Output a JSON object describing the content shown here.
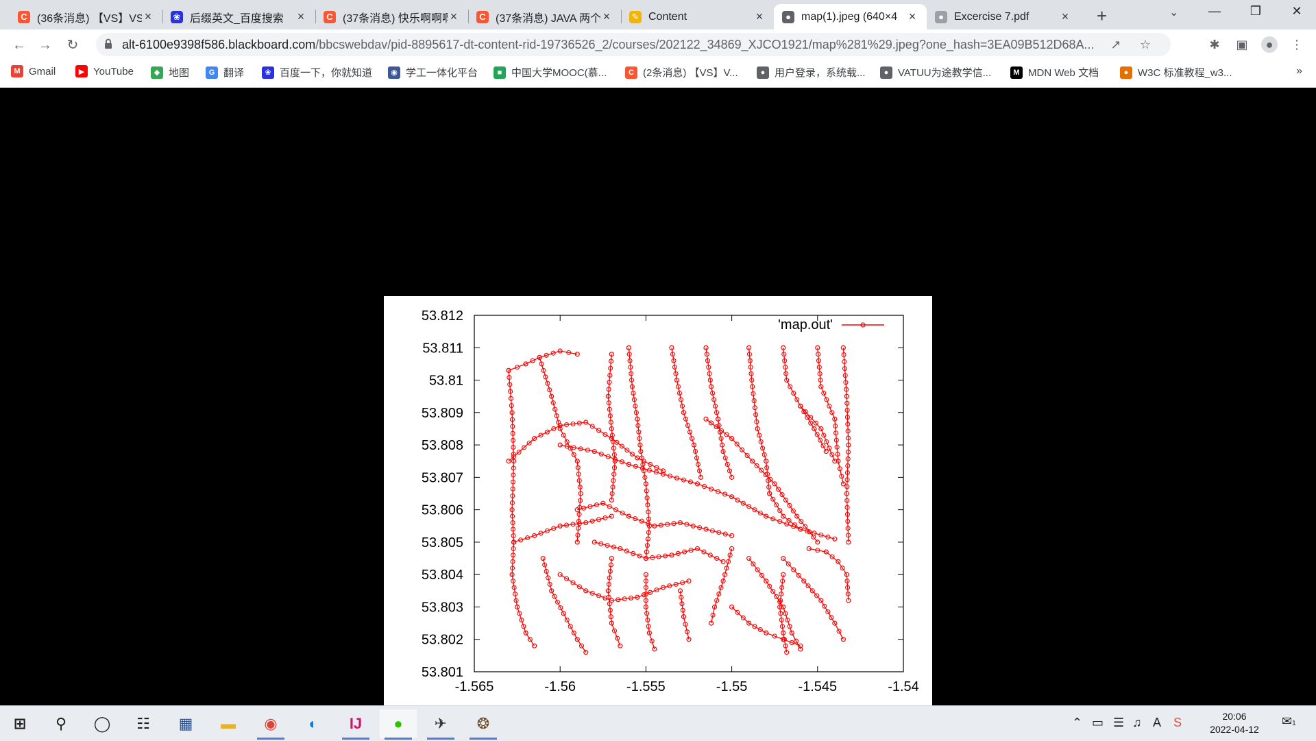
{
  "browser": {
    "tabs": [
      {
        "title": "(36条消息) 【VS】VS",
        "favicon": "csdn-icon",
        "color": "#fc5531"
      },
      {
        "title": "后缀英文_百度搜索",
        "favicon": "baidu-icon",
        "color": "#2932e1"
      },
      {
        "title": "(37条消息) 快乐啊啊啊",
        "favicon": "csdn-icon",
        "color": "#fc5531"
      },
      {
        "title": "(37条消息) JAVA 两个",
        "favicon": "csdn-icon",
        "color": "#fc5531"
      },
      {
        "title": "Content",
        "favicon": "blackboard-icon",
        "color": "#f4b400"
      },
      {
        "title": "map(1).jpeg (640×4",
        "favicon": "globe-icon",
        "color": "#5f6368",
        "active": true
      },
      {
        "title": "Excercise 7.pdf",
        "favicon": "globe-icon",
        "color": "#9aa0a6"
      }
    ],
    "url_host": "alt-6100e9398f586.blackboard.com",
    "url_path": "/bbcswebdav/pid-8895617-dt-content-rid-19736526_2/courses/202122_34869_XJCO1921/map%281%29.jpeg?one_hash=3EA09B512D68A...",
    "bookmarks": [
      {
        "label": "Gmail",
        "icon": "gmail-icon",
        "color": "#ea4335"
      },
      {
        "label": "YouTube",
        "icon": "youtube-icon",
        "color": "#ff0000"
      },
      {
        "label": "地图",
        "icon": "maps-icon",
        "color": "#34a853"
      },
      {
        "label": "翻译",
        "icon": "translate-icon",
        "color": "#4285f4"
      },
      {
        "label": "百度一下，你就知道",
        "icon": "baidu-icon",
        "color": "#2932e1"
      },
      {
        "label": "学工一体化平台",
        "icon": "school-icon",
        "color": "#3b5998"
      },
      {
        "label": "中国大学MOOC(慕...",
        "icon": "mooc-icon",
        "color": "#21a557"
      },
      {
        "label": "(2条消息) 【VS】V...",
        "icon": "csdn-icon",
        "color": "#fc5531"
      },
      {
        "label": "用户登录，系统载...",
        "icon": "globe-icon",
        "color": "#5f6368"
      },
      {
        "label": "VATUU为途教学信...",
        "icon": "globe-icon",
        "color": "#5f6368"
      },
      {
        "label": "MDN Web 文档",
        "icon": "mdn-icon",
        "color": "#000000"
      },
      {
        "label": "W3C 标准教程_w3...",
        "icon": "w3c-icon",
        "color": "#e76f00"
      }
    ]
  },
  "chart_data": {
    "type": "scatter",
    "mode": "linespoints",
    "title": "",
    "legend": "'map.out'",
    "legend_position": "top-right",
    "series_color": "#ff0000",
    "xlabel": "",
    "ylabel": "",
    "xlim": [
      -1.565,
      -1.54
    ],
    "ylim": [
      53.801,
      53.812
    ],
    "xticks": [
      "-1.565",
      "-1.56",
      "-1.555",
      "-1.55",
      "-1.545",
      "-1.54"
    ],
    "yticks": [
      "53.812",
      "53.811",
      "53.81",
      "53.809",
      "53.808",
      "53.807",
      "53.806",
      "53.805",
      "53.804",
      "53.803",
      "53.802",
      "53.801"
    ],
    "data_extent": {
      "x": [
        -1.564,
        -1.543
      ],
      "y": [
        53.8016,
        53.811
      ]
    },
    "polylines": [
      [
        [
          -1.563,
          53.8103
        ],
        [
          -1.562,
          53.8105
        ],
        [
          -1.5612,
          53.8107
        ],
        [
          -1.56,
          53.8109
        ],
        [
          -1.559,
          53.8108
        ]
      ],
      [
        [
          -1.563,
          53.8103
        ],
        [
          -1.5628,
          53.809
        ],
        [
          -1.5627,
          53.8075
        ],
        [
          -1.5628,
          53.806
        ],
        [
          -1.5627,
          53.805
        ]
      ],
      [
        [
          -1.5627,
          53.805
        ],
        [
          -1.5615,
          53.8052
        ],
        [
          -1.56,
          53.8055
        ],
        [
          -1.5585,
          53.8056
        ],
        [
          -1.557,
          53.8058
        ]
      ],
      [
        [
          -1.563,
          53.8075
        ],
        [
          -1.5615,
          53.8082
        ],
        [
          -1.56,
          53.8086
        ],
        [
          -1.5585,
          53.8087
        ],
        [
          -1.557,
          53.8082
        ],
        [
          -1.5555,
          53.8076
        ],
        [
          -1.554,
          53.8072
        ]
      ],
      [
        [
          -1.5612,
          53.8107
        ],
        [
          -1.5605,
          53.8095
        ],
        [
          -1.56,
          53.8085
        ],
        [
          -1.559,
          53.8075
        ],
        [
          -1.5588,
          53.8065
        ],
        [
          -1.559,
          53.805
        ]
      ],
      [
        [
          -1.557,
          53.8108
        ],
        [
          -1.5572,
          53.8095
        ],
        [
          -1.557,
          53.8085
        ],
        [
          -1.5568,
          53.8075
        ],
        [
          -1.557,
          53.8063
        ]
      ],
      [
        [
          -1.556,
          53.811
        ],
        [
          -1.5558,
          53.8098
        ],
        [
          -1.5555,
          53.8088
        ],
        [
          -1.5553,
          53.8078
        ],
        [
          -1.555,
          53.8068
        ],
        [
          -1.5548,
          53.8055
        ],
        [
          -1.555,
          53.8045
        ]
      ],
      [
        [
          -1.5535,
          53.811
        ],
        [
          -1.5532,
          53.81
        ],
        [
          -1.5528,
          53.809
        ],
        [
          -1.5522,
          53.808
        ],
        [
          -1.5518,
          53.807
        ]
      ],
      [
        [
          -1.5515,
          53.811
        ],
        [
          -1.5512,
          53.8098
        ],
        [
          -1.5508,
          53.8088
        ],
        [
          -1.5505,
          53.8078
        ],
        [
          -1.55,
          53.807
        ]
      ],
      [
        [
          -1.549,
          53.811
        ],
        [
          -1.5488,
          53.8098
        ],
        [
          -1.5485,
          53.8085
        ],
        [
          -1.548,
          53.8075
        ],
        [
          -1.5478,
          53.8065
        ]
      ],
      [
        [
          -1.547,
          53.811
        ],
        [
          -1.5468,
          53.81
        ],
        [
          -1.546,
          53.8092
        ],
        [
          -1.5452,
          53.8085
        ],
        [
          -1.5445,
          53.8078
        ]
      ],
      [
        [
          -1.545,
          53.811
        ],
        [
          -1.5448,
          53.8098
        ],
        [
          -1.544,
          53.8088
        ],
        [
          -1.5438,
          53.8075
        ],
        [
          -1.5435,
          53.8068
        ]
      ],
      [
        [
          -1.5435,
          53.811
        ],
        [
          -1.5433,
          53.8095
        ],
        [
          -1.5432,
          53.808
        ],
        [
          -1.5433,
          53.8065
        ],
        [
          -1.5432,
          53.805
        ]
      ],
      [
        [
          -1.5515,
          53.8088
        ],
        [
          -1.55,
          53.8082
        ],
        [
          -1.5488,
          53.8075
        ],
        [
          -1.5475,
          53.8068
        ],
        [
          -1.5462,
          53.8058
        ],
        [
          -1.545,
          53.805
        ]
      ],
      [
        [
          -1.56,
          53.808
        ],
        [
          -1.558,
          53.8078
        ],
        [
          -1.556,
          53.8074
        ],
        [
          -1.554,
          53.8071
        ],
        [
          -1.552,
          53.8068
        ],
        [
          -1.55,
          53.8064
        ],
        [
          -1.548,
          53.8058
        ],
        [
          -1.546,
          53.8054
        ],
        [
          -1.544,
          53.8051
        ]
      ],
      [
        [
          -1.559,
          53.806
        ],
        [
          -1.5575,
          53.8062
        ],
        [
          -1.556,
          53.8058
        ],
        [
          -1.5545,
          53.8055
        ],
        [
          -1.553,
          53.8056
        ],
        [
          -1.5515,
          53.8054
        ],
        [
          -1.55,
          53.8052
        ]
      ],
      [
        [
          -1.558,
          53.805
        ],
        [
          -1.5565,
          53.8048
        ],
        [
          -1.555,
          53.8045
        ],
        [
          -1.5535,
          53.8046
        ],
        [
          -1.552,
          53.8048
        ],
        [
          -1.5505,
          53.8044
        ]
      ],
      [
        [
          -1.5627,
          53.805
        ],
        [
          -1.5628,
          53.804
        ],
        [
          -1.5625,
          53.803
        ],
        [
          -1.562,
          53.8022
        ],
        [
          -1.5615,
          53.8018
        ]
      ],
      [
        [
          -1.561,
          53.8045
        ],
        [
          -1.5605,
          53.8035
        ],
        [
          -1.5598,
          53.8028
        ],
        [
          -1.559,
          53.802
        ],
        [
          -1.5585,
          53.8016
        ]
      ],
      [
        [
          -1.56,
          53.804
        ],
        [
          -1.5585,
          53.8035
        ],
        [
          -1.557,
          53.8032
        ],
        [
          -1.5555,
          53.8033
        ],
        [
          -1.554,
          53.8036
        ],
        [
          -1.5525,
          53.8038
        ]
      ],
      [
        [
          -1.557,
          53.8045
        ],
        [
          -1.5572,
          53.8035
        ],
        [
          -1.557,
          53.8025
        ],
        [
          -1.5565,
          53.8018
        ]
      ],
      [
        [
          -1.555,
          53.804
        ],
        [
          -1.555,
          53.803
        ],
        [
          -1.5548,
          53.8022
        ],
        [
          -1.5545,
          53.8017
        ]
      ],
      [
        [
          -1.553,
          53.8035
        ],
        [
          -1.5528,
          53.8027
        ],
        [
          -1.5525,
          53.802
        ]
      ],
      [
        [
          -1.55,
          53.8048
        ],
        [
          -1.5505,
          53.8038
        ],
        [
          -1.551,
          53.803
        ],
        [
          -1.5512,
          53.8025
        ]
      ],
      [
        [
          -1.549,
          53.8045
        ],
        [
          -1.548,
          53.8038
        ],
        [
          -1.547,
          53.803
        ],
        [
          -1.5465,
          53.8022
        ],
        [
          -1.546,
          53.8017
        ]
      ],
      [
        [
          -1.547,
          53.8045
        ],
        [
          -1.5458,
          53.8038
        ],
        [
          -1.5448,
          53.8032
        ],
        [
          -1.544,
          53.8025
        ],
        [
          -1.5435,
          53.802
        ]
      ],
      [
        [
          -1.5455,
          53.8048
        ],
        [
          -1.5445,
          53.8047
        ],
        [
          -1.5438,
          53.8044
        ],
        [
          -1.5433,
          53.804
        ],
        [
          -1.5432,
          53.8032
        ]
      ],
      [
        [
          -1.547,
          53.804
        ],
        [
          -1.5472,
          53.803
        ],
        [
          -1.547,
          53.8022
        ],
        [
          -1.5468,
          53.8016
        ]
      ],
      [
        [
          -1.55,
          53.803
        ],
        [
          -1.549,
          53.8025
        ],
        [
          -1.548,
          53.8022
        ],
        [
          -1.547,
          53.802
        ],
        [
          -1.546,
          53.8018
        ]
      ],
      [
        [
          -1.546,
          53.8092
        ],
        [
          -1.5448,
          53.8085
        ],
        [
          -1.544,
          53.8075
        ]
      ],
      [
        [
          -1.5478,
          53.8065
        ],
        [
          -1.547,
          53.8058
        ],
        [
          -1.546,
          53.8054
        ]
      ]
    ]
  },
  "taskbar": {
    "apps": [
      {
        "name": "start-button"
      },
      {
        "name": "search-icon"
      },
      {
        "name": "cortana-icon"
      },
      {
        "name": "task-view-icon"
      },
      {
        "name": "store-icon"
      },
      {
        "name": "file-explorer-icon"
      },
      {
        "name": "chrome-icon",
        "running": true
      },
      {
        "name": "edge-icon"
      },
      {
        "name": "intellij-icon",
        "running": true
      },
      {
        "name": "wechat-icon",
        "running": true
      },
      {
        "name": "app-icon",
        "running": true
      },
      {
        "name": "app-icon-2",
        "running": true
      }
    ],
    "time": "20:06",
    "date": "2022-04-12",
    "notifications": "1"
  }
}
